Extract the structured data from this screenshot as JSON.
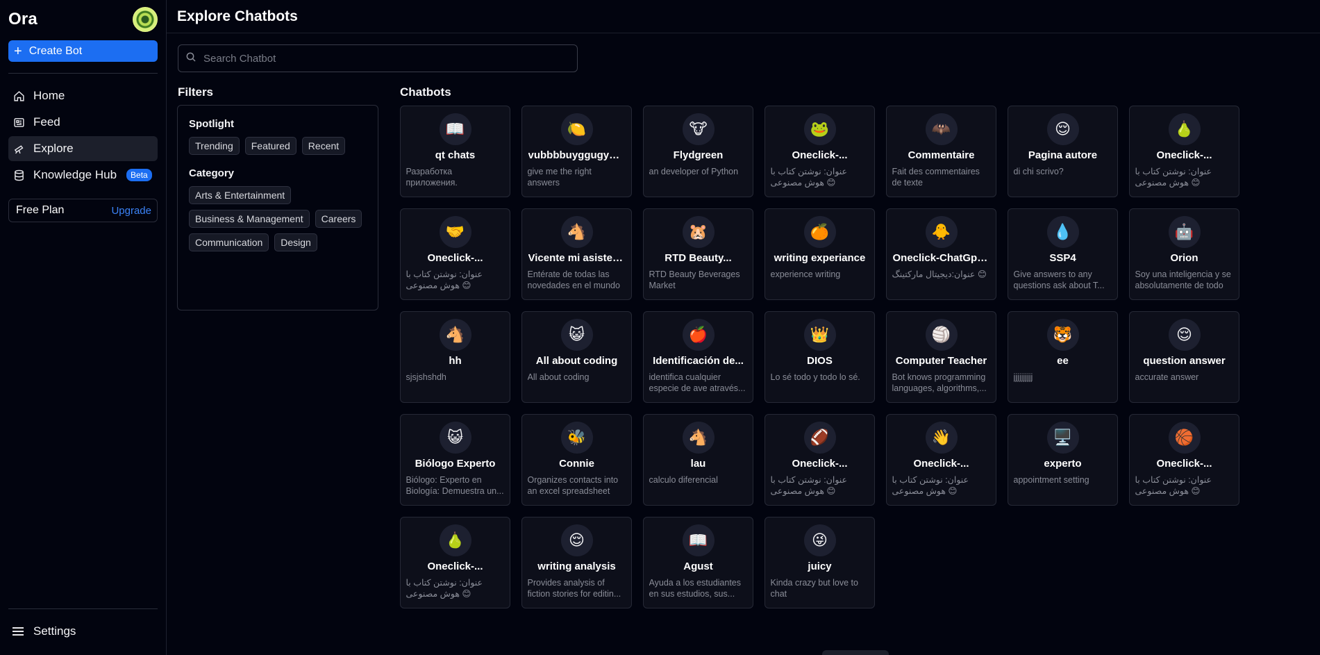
{
  "sidebar": {
    "brand": "Ora",
    "create_label": "Create Bot",
    "nav": [
      {
        "label": "Home",
        "icon": "home-icon"
      },
      {
        "label": "Feed",
        "icon": "feed-icon"
      },
      {
        "label": "Explore",
        "icon": "explore-icon",
        "active": true
      },
      {
        "label": "Knowledge Hub",
        "icon": "database-icon",
        "badge": "Beta"
      }
    ],
    "plan": "Free Plan",
    "upgrade": "Upgrade",
    "settings": "Settings"
  },
  "header": {
    "title": "Explore Chatbots"
  },
  "search": {
    "placeholder": "Search Chatbot"
  },
  "filters": {
    "title": "Filters",
    "spotlight_label": "Spotlight",
    "spotlight": [
      "Trending",
      "Featured",
      "Recent"
    ],
    "category_label": "Category",
    "categories": [
      "Arts & Entertainment",
      "Business & Management",
      "Careers",
      "Communication",
      "Design"
    ]
  },
  "chatbots": {
    "title": "Chatbots",
    "items": [
      {
        "emoji": "📖",
        "name": "qt chats",
        "desc": "Разработка приложения."
      },
      {
        "emoji": "🍋",
        "name": "vubbbbuyggugyugug",
        "desc": "give me the right answers"
      },
      {
        "emoji": "🐮",
        "name": "Flydgreen",
        "desc": "an developer of Python"
      },
      {
        "emoji": "🐸",
        "name": "Oneclick-...",
        "desc": "عنوان: نوشتن کتاب با هوش مصنوعی 😊"
      },
      {
        "emoji": "🦇",
        "name": "Commentaire",
        "desc": "Fait des commentaires de texte"
      },
      {
        "emoji": "😌",
        "name": "Pagina autore",
        "desc": "di chi scrivo?"
      },
      {
        "emoji": "🍐",
        "name": "Oneclick-...",
        "desc": "عنوان: نوشتن کتاب با هوش مصنوعی 😊"
      },
      {
        "emoji": "🤝",
        "name": "Oneclick-...",
        "desc": "عنوان: نوشتن کتاب با هوش مصنوعی 😊"
      },
      {
        "emoji": "🐴",
        "name": "Vicente mi asistente",
        "desc": "Entérate de todas las novedades en el mundo"
      },
      {
        "emoji": "🐹",
        "name": "RTD Beauty...",
        "desc": "RTD Beauty Beverages Market"
      },
      {
        "emoji": "🍊",
        "name": "writing experiance",
        "desc": "experience writing"
      },
      {
        "emoji": "🐥",
        "name": "Oneclick-ChatGpt-...",
        "desc": "عنوان:دیجیتال مارکتینگ 😊"
      },
      {
        "emoji": "💧",
        "name": "SSP4",
        "desc": "Give answers to any questions ask about T..."
      },
      {
        "emoji": "🤖",
        "name": "Orion",
        "desc": "Soy una inteligencia y se absolutamente de todo"
      },
      {
        "emoji": "🐴",
        "name": "hh",
        "desc": "sjsjshshdh"
      },
      {
        "emoji": "😺",
        "name": "All about coding",
        "desc": "All about coding"
      },
      {
        "emoji": "🍎",
        "name": "Identificación de...",
        "desc": "identifica cualquier especie de ave através..."
      },
      {
        "emoji": "👑",
        "name": "DIOS",
        "desc": "Lo sé todo y todo lo sé."
      },
      {
        "emoji": "🏐",
        "name": "Computer Teacher",
        "desc": "Bot knows programming languages, algorithms,..."
      },
      {
        "emoji": "🐯",
        "name": "ee",
        "desc": "jjjjjjjjjj"
      },
      {
        "emoji": "😌",
        "name": "question answer",
        "desc": "accurate answer"
      },
      {
        "emoji": "😺",
        "name": "Biólogo Experto",
        "desc": "Biólogo: Experto en Biología: Demuestra un..."
      },
      {
        "emoji": "🐝",
        "name": "Connie",
        "desc": "Organizes contacts into an excel spreadsheet"
      },
      {
        "emoji": "🐴",
        "name": "lau",
        "desc": "calculo diferencial"
      },
      {
        "emoji": "🏈",
        "name": "Oneclick-...",
        "desc": "عنوان: نوشتن کتاب با هوش مصنوعی 😊"
      },
      {
        "emoji": "👋",
        "name": "Oneclick-...",
        "desc": "عنوان: نوشتن کتاب با هوش مصنوعی 😊"
      },
      {
        "emoji": "🖥️",
        "name": "experto",
        "desc": "appointment setting"
      },
      {
        "emoji": "🏀",
        "name": "Oneclick-...",
        "desc": "عنوان: نوشتن کتاب با هوش مصنوعی 😊"
      },
      {
        "emoji": "🍐",
        "name": "Oneclick-...",
        "desc": "عنوان: نوشتن کتاب با هوش مصنوعی 😊"
      },
      {
        "emoji": "😌",
        "name": "writing analysis",
        "desc": "Provides analysis of fiction stories for editin..."
      },
      {
        "emoji": "📖",
        "name": "Agust",
        "desc": "Ayuda a los estudiantes en sus estudios, sus..."
      },
      {
        "emoji": "😜",
        "name": "juicy",
        "desc": "Kinda crazy but love to chat"
      }
    ]
  }
}
